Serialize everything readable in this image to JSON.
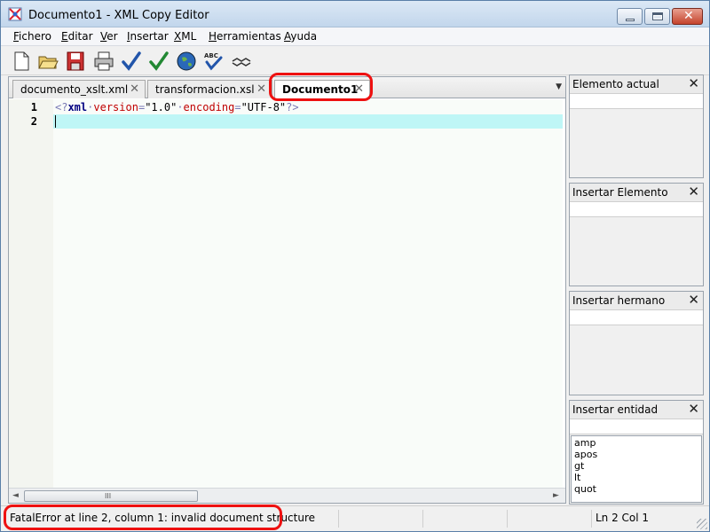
{
  "window": {
    "title": "Documento1 - XML Copy Editor",
    "close_glyph": "✕"
  },
  "menu": [
    {
      "label": "Fichero",
      "accel": "F",
      "rest": "ichero"
    },
    {
      "label": "Editar",
      "accel": "E",
      "rest": "ditar"
    },
    {
      "label": "Ver",
      "accel": "V",
      "rest": "er"
    },
    {
      "label": "Insertar",
      "accel": "I",
      "rest": "nsertar"
    },
    {
      "label": "XML",
      "accel": "X",
      "rest": "ML"
    },
    {
      "label": "Herramientas",
      "accel": "H",
      "rest": "erramientas"
    },
    {
      "label": "Ayuda",
      "accel": "A",
      "rest": "yuda"
    }
  ],
  "toolbar": {
    "icons": [
      "new-document-icon",
      "open-folder-icon",
      "save-disk-icon",
      "print-icon",
      "check-wellformed-icon",
      "validate-icon",
      "browser-globe-icon",
      "spellcheck-icon",
      "pretty-print-icon"
    ]
  },
  "tabs": [
    {
      "label": "documento_xslt.xml",
      "active": false
    },
    {
      "label": "transformacion.xsl",
      "active": false
    },
    {
      "label": "Documento1",
      "active": true
    }
  ],
  "tab_close_glyph": "✕",
  "tab_menu_glyph": "▼",
  "editor": {
    "line_numbers": [
      "1",
      "2"
    ],
    "line1": {
      "open": "<?",
      "name": "xml",
      "dot1": "·",
      "attr1": "version",
      "eq1": "=",
      "val1": "\"1.0\"",
      "dot2": "·",
      "attr2": "encoding",
      "eq2": "=",
      "val2": "\"UTF-8\"",
      "close": "?>"
    },
    "hscroll_left": "◄",
    "hscroll_right": "►",
    "hscroll_grip": "III"
  },
  "panels": [
    {
      "title": "Elemento actual",
      "items": []
    },
    {
      "title": "Insertar Elemento",
      "items": []
    },
    {
      "title": "Insertar hermano",
      "items": []
    },
    {
      "title": "Insertar entidad",
      "items": [
        "amp",
        "apos",
        "gt",
        "lt",
        "quot"
      ]
    }
  ],
  "panel_close_glyph": "✕",
  "status": {
    "message": "FatalError at line 2, column 1: invalid document structure",
    "position": "Ln 2 Col 1"
  },
  "colors": {
    "highlight_ring": "#ee1111",
    "caret_line": "#bff6f6",
    "xml_name": "#000080",
    "xml_attr": "#c00000"
  }
}
